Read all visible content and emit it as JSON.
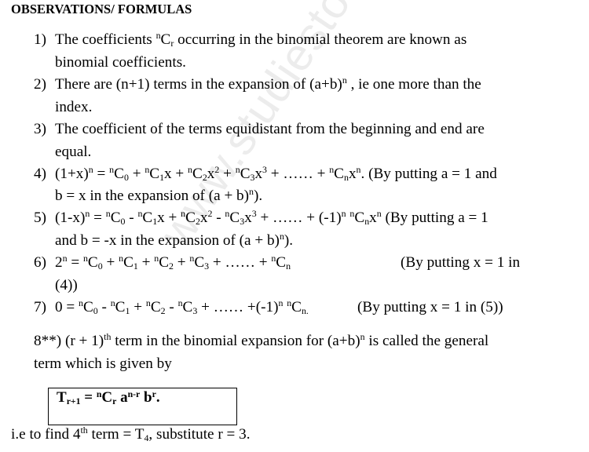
{
  "watermark": "www.studiesto",
  "heading": "OBSERVATIONS/ FORMULAS",
  "items": [
    {
      "num": "1)",
      "line1_a": "The coefficients ",
      "line1_b": " occurring in the binomial theorem are known as",
      "line2": "binomial coefficients."
    },
    {
      "num": "2)",
      "line1_a": "There are (n+1) terms in the expansion of (a+b)",
      "line1_b": " , ie one more than the",
      "line2": "index."
    },
    {
      "num": "3)",
      "line1": "The coefficient of the terms equidistant from the beginning and end are",
      "line2": "equal."
    },
    {
      "num": "4)",
      "note": "(By putting a = 1 and",
      "line2_a": "b = x in the expansion of (a + b)",
      "line2_b": ")."
    },
    {
      "num": "5)",
      "note": "(By putting a = 1",
      "line2_a": "and b = -x in the expansion of (a + b)",
      "line2_b": ")."
    },
    {
      "num": "6)",
      "note": "(By putting x = 1 in",
      "line2": "(4))"
    },
    {
      "num": "7)",
      "note": "(By putting x = 1 in (5))"
    }
  ],
  "item8": {
    "line1_a": "8**) (r + 1)",
    "line1_sup": "th",
    "line1_b": " term in the binomial expansion for (a+b)",
    "line1_c": " is called the general",
    "line2": "term  which is given by"
  },
  "formula": {
    "lhs": "T",
    "lhs_sub": "r+1",
    "rhs": "C",
    "rhs_sub": "r",
    "a_exp": "n-r",
    "b_exp": "r"
  },
  "footer": {
    "a": "i.e to find 4",
    "sup": "th",
    "b": " term = T",
    "sub": "4",
    "c": ", substitute r = 3."
  },
  "symbols": {
    "n": "n",
    "dots": "……"
  }
}
